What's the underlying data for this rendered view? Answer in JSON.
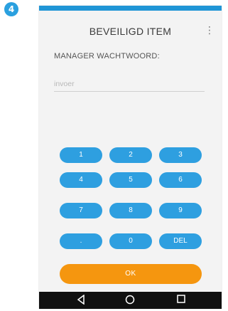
{
  "step": {
    "number": "4",
    "color": "#2aa0df"
  },
  "app": {
    "title": "BEVEILIGD ITEM",
    "menu_icon": "more-vert-icon",
    "status_bar_color": "#1f95d6"
  },
  "form": {
    "field_label": "MANAGER WACHTWOORD:",
    "input_value": "",
    "input_placeholder": "invoer"
  },
  "keypad": {
    "key_color": "#2e9fe0",
    "keys": [
      "1",
      "2",
      "3",
      "4",
      "5",
      "6",
      "7",
      "8",
      "9",
      ".",
      "0",
      "DEL"
    ],
    "ok_label": "OK",
    "ok_color": "#f5960f"
  },
  "nav": {
    "back_icon": "back-triangle-icon",
    "home_icon": "home-circle-icon",
    "recents_icon": "recents-square-icon"
  }
}
